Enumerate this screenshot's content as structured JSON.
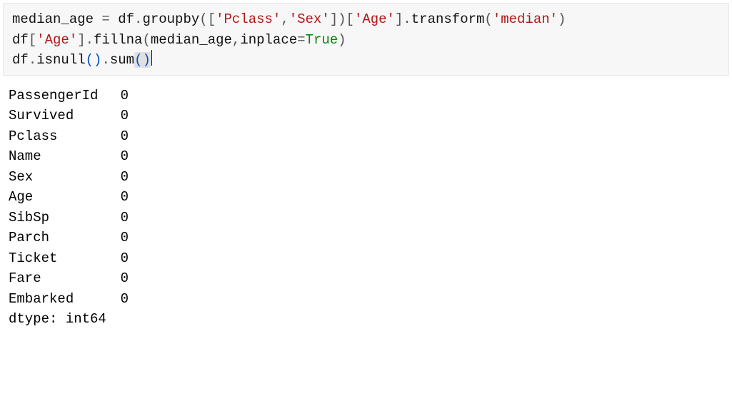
{
  "code": {
    "l1": {
      "t1": "median_age ",
      "op1": "= ",
      "t2": "df",
      "dot1": ".",
      "fn1": "groupby",
      "p1": "(",
      "b1": "[",
      "s1": "'Pclass'",
      "c1": ",",
      "s2": "'Sex'",
      "b2": "]",
      "p2": ")",
      "b3": "[",
      "s3": "'Age'",
      "b4": "]",
      "dot2": ".",
      "fn2": "transform",
      "p3": "(",
      "s4": "'median'",
      "p4": ")"
    },
    "l2": {
      "t1": "df",
      "b1": "[",
      "s1": "'Age'",
      "b2": "]",
      "dot1": ".",
      "fn1": "fillna",
      "p1": "(",
      "t2": "median_age",
      "c1": ",",
      "t3": "inplace",
      "op1": "=",
      "bool1": "True",
      "p2": ")"
    },
    "l3": {
      "t1": "df",
      "dot1": ".",
      "fn1": "isnull",
      "p1": "(",
      "p2": ")",
      "dot2": ".",
      "fn2": "sum",
      "p3": "(",
      "p4": ")"
    }
  },
  "output": {
    "rows": [
      {
        "label": "PassengerId",
        "value": "0"
      },
      {
        "label": "Survived",
        "value": "0"
      },
      {
        "label": "Pclass",
        "value": "0"
      },
      {
        "label": "Name",
        "value": "0"
      },
      {
        "label": "Sex",
        "value": "0"
      },
      {
        "label": "Age",
        "value": "0"
      },
      {
        "label": "SibSp",
        "value": "0"
      },
      {
        "label": "Parch",
        "value": "0"
      },
      {
        "label": "Ticket",
        "value": "0"
      },
      {
        "label": "Fare",
        "value": "0"
      },
      {
        "label": "Embarked",
        "value": "0"
      }
    ],
    "dtype": "dtype: int64"
  }
}
